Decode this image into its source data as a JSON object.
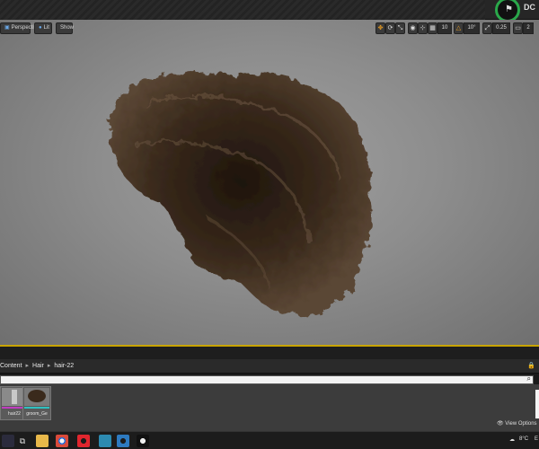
{
  "window": {
    "dc_label": "DC",
    "flag_glyph": "⚑"
  },
  "viewport": {
    "perspective_label": "Perspective",
    "lit_label": "Lit",
    "show_label": "Show",
    "grid_snap": "10",
    "rotation_snap": "10°",
    "scale_snap": "0.25",
    "camera_speed": "2"
  },
  "content_browser": {
    "breadcrumb": [
      "Content",
      "Hair",
      "hair-22"
    ],
    "assets": [
      {
        "label": "hair22",
        "stripe_color": "#c03cc0"
      },
      {
        "label": "groom_Ge",
        "stripe_color": "#2fc0c0"
      }
    ],
    "view_options_label": "View Options"
  },
  "taskbar": {
    "weather": "8°C",
    "lang": "E"
  },
  "colors": {
    "accent": "#c8a400",
    "hair": "#3a2a1c"
  }
}
